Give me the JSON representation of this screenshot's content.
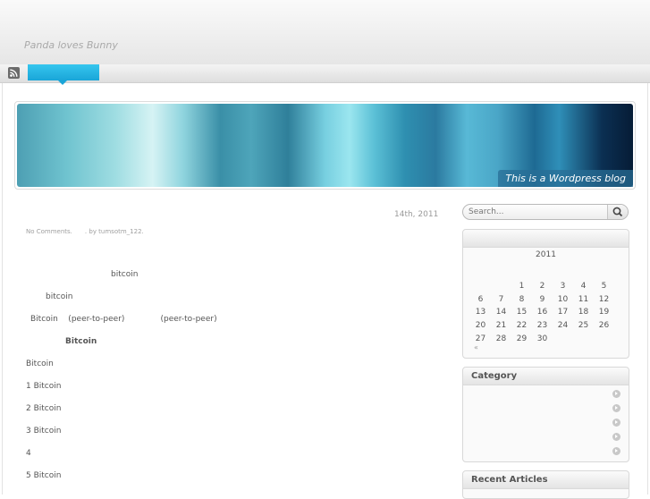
{
  "site": {
    "title": "Panda loves Bunny"
  },
  "nav": {
    "active_item": ""
  },
  "banner": {
    "caption": "This is a Wordpress blog"
  },
  "post": {
    "date": "14th, 2011",
    "meta": {
      "comments": "No Comments.",
      "author": ". by tumsotm_122."
    },
    "lines": [
      "bitcoin",
      "bitcoin",
      "Bitcoin    (peer-to-peer)              (peer-to-peer)",
      "Bitcoin",
      "Bitcoin",
      "1 Bitcoin",
      "2 Bitcoin",
      "3 Bitcoin",
      "4",
      "5 Bitcoin"
    ]
  },
  "search": {
    "placeholder": "Search..."
  },
  "calendar": {
    "year": "2011",
    "weeks": [
      [
        "",
        "",
        "1",
        "2",
        "3",
        "4",
        "5"
      ],
      [
        "6",
        "7",
        "8",
        "9",
        "10",
        "11",
        "12"
      ],
      [
        "13",
        "14",
        "15",
        "16",
        "17",
        "18",
        "19"
      ],
      [
        "20",
        "21",
        "22",
        "23",
        "24",
        "25",
        "26"
      ],
      [
        "27",
        "28",
        "29",
        "30",
        "",
        "",
        ""
      ]
    ],
    "prev_link": "«"
  },
  "category": {
    "title": "Category",
    "items": [
      "",
      "",
      "",
      "",
      ""
    ]
  },
  "recent": {
    "title": "Recent Articles"
  },
  "icons": {
    "rss": "rss-icon",
    "search": "magnifier-icon",
    "bullet": "arrow-circle-icon"
  },
  "colors": {
    "accent": "#1aa5d8",
    "banner_caption_bg": "#286e96"
  }
}
